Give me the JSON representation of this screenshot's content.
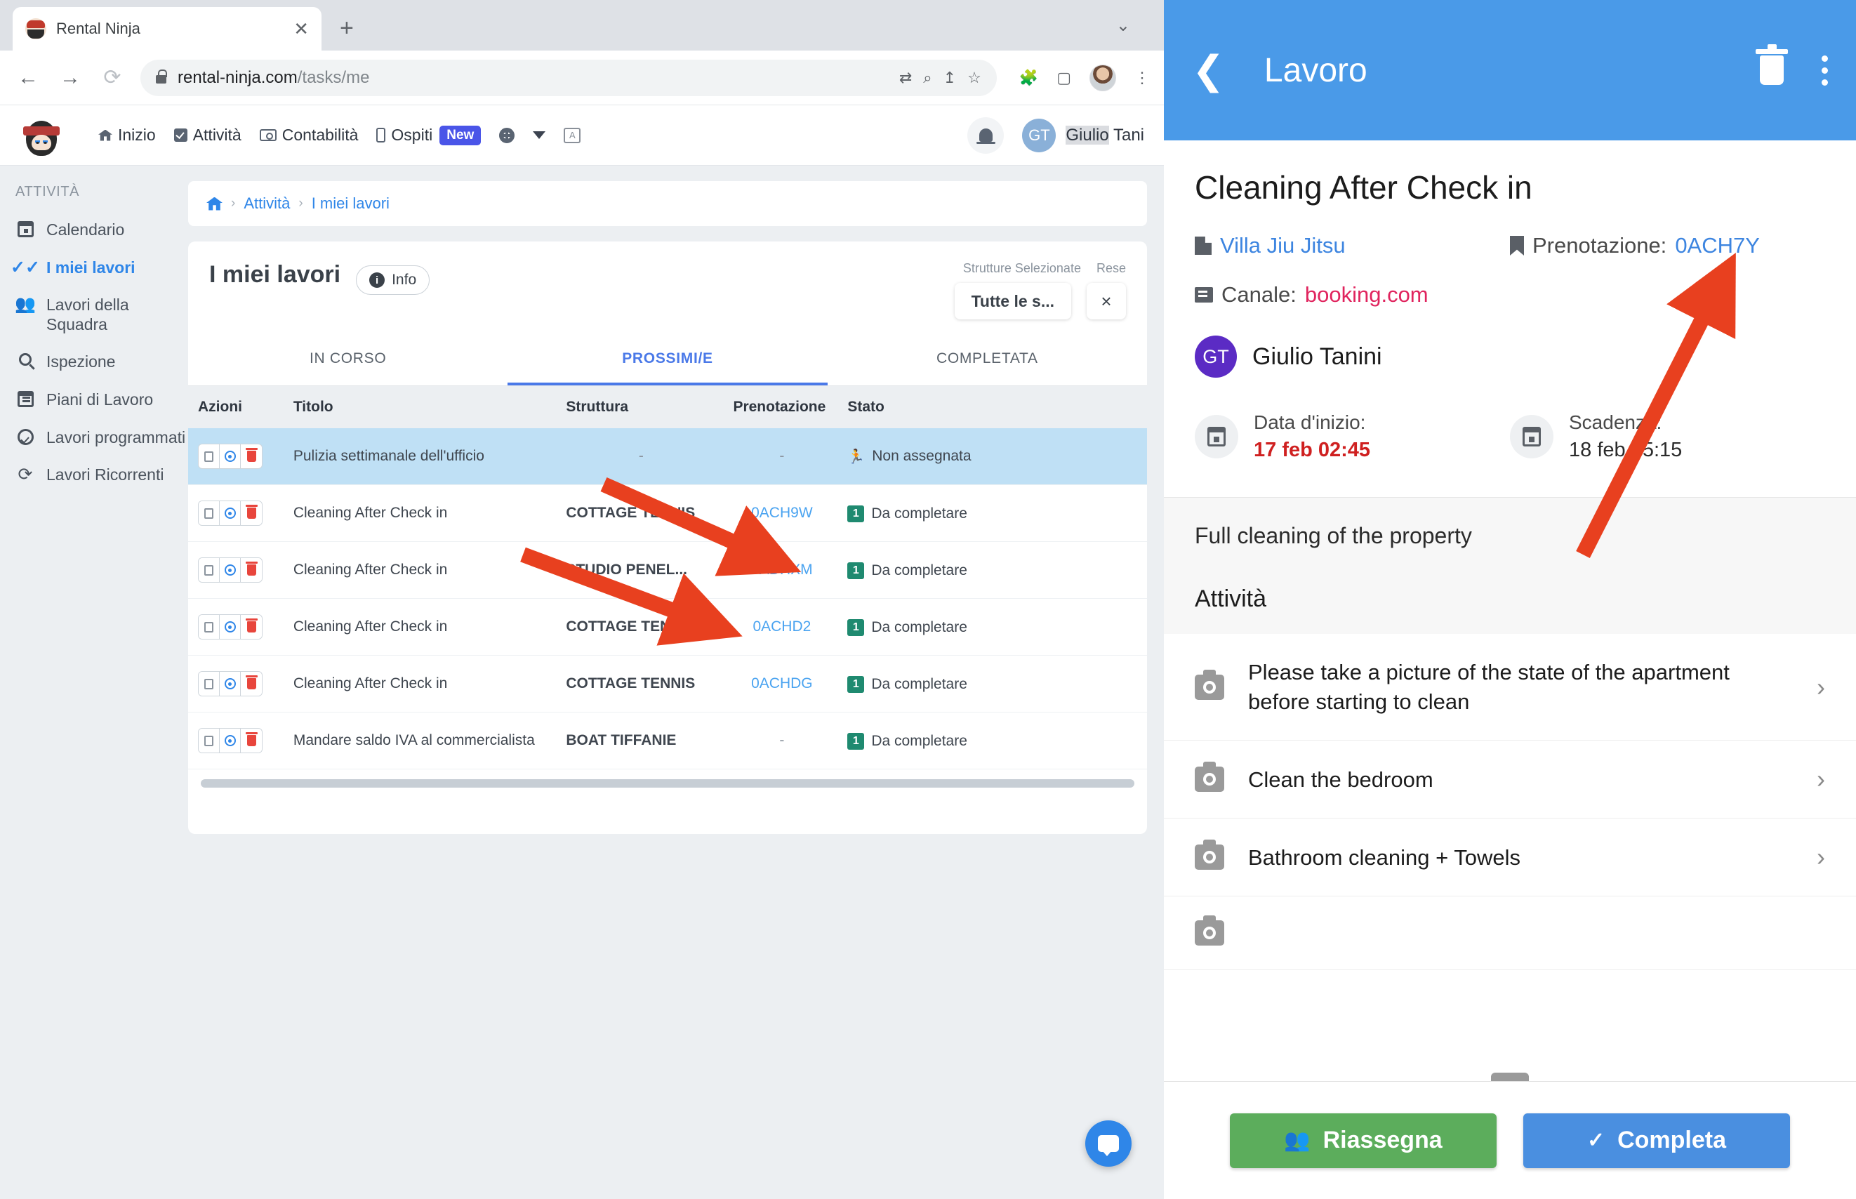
{
  "browser": {
    "tab_title": "Rental Ninja",
    "tab_close": "✕",
    "new_tab": "+",
    "tabstrip_chevron": "⌄",
    "back": "←",
    "forward": "→",
    "reload": "⟳",
    "url_host": "rental-ninja.com",
    "url_path": "/tasks/me",
    "translate_icon": "⇄",
    "zoom_icon": "⌕",
    "share_icon": "↥",
    "bookmark_icon": "☆",
    "extensions_icon": "🧩",
    "sidepanel_icon": "▢",
    "menu_icon": "⋮"
  },
  "app_header": {
    "logo": "ninja-logo",
    "nav": [
      {
        "label": "Inizio",
        "icon": "home-icon"
      },
      {
        "label": "Attività",
        "icon": "checkbox-icon"
      },
      {
        "label": "Contabilità",
        "icon": "money-icon"
      },
      {
        "label": "Ospiti",
        "icon": "phone-icon",
        "badge": "New"
      }
    ],
    "gear_icon": "gear-icon",
    "caret_icon": "chevron-down-icon",
    "translate_icon": "A",
    "bell_icon": "bell-icon",
    "user_initials": "GT",
    "user_name_highlight": "Giulio",
    "user_name_rest": " Tani"
  },
  "sidebar": {
    "section_label": "ATTIVITÀ",
    "items": [
      {
        "label": "Calendario",
        "icon": "calendar-icon",
        "active": false
      },
      {
        "label": "I miei lavori",
        "icon": "double-check-icon",
        "active": true
      },
      {
        "label": "Lavori della Squadra",
        "icon": "people-icon",
        "active": false
      },
      {
        "label": "Ispezione",
        "icon": "search-icon",
        "active": false
      },
      {
        "label": "Piani di Lavoro",
        "icon": "calendar-lines-icon",
        "active": false
      },
      {
        "label": "Lavori programmati",
        "icon": "clock-check-icon",
        "active": false
      },
      {
        "label": "Lavori Ricorrenti",
        "icon": "sync-icon",
        "active": false
      }
    ]
  },
  "breadcrumb": {
    "home_icon": "home-icon",
    "sep": "›",
    "item1": "Attività",
    "item2": "I miei lavori"
  },
  "panel": {
    "title": "I miei lavori",
    "info_label": "Info",
    "info_icon": "info-icon",
    "filter_label_1": "Strutture Selezionate",
    "filter_label_2": "Rese",
    "filter_value": "Tutte le s...",
    "filter_reset": "×"
  },
  "tabs": [
    {
      "label": "IN CORSO",
      "active": false
    },
    {
      "label": "PROSSIMI/E",
      "active": true
    },
    {
      "label": "COMPLETATA",
      "active": false
    }
  ],
  "table": {
    "headers": [
      "Azioni",
      "Titolo",
      "Struttura",
      "Prenotazione",
      "Stato"
    ],
    "rows": [
      {
        "title": "Pulizia settimanale dell'ufficio",
        "struttura": "-",
        "prenotazione": "-",
        "stato": "Non assegnata",
        "stato_type": "unassigned",
        "highlight": true
      },
      {
        "title": "Cleaning After Check in",
        "struttura": "COTTAGE TENNIS",
        "prenotazione": "0ACH9W",
        "stato": "Da completare",
        "stato_badge": "1",
        "stato_type": "todo",
        "highlight": false
      },
      {
        "title": "Cleaning After Check in",
        "struttura": "STUDIO PENEL...",
        "prenotazione": "0ADHXM",
        "stato": "Da completare",
        "stato_badge": "1",
        "stato_type": "todo",
        "highlight": false
      },
      {
        "title": "Cleaning After Check in",
        "struttura": "COTTAGE TENNIS",
        "prenotazione": "0ACHD2",
        "stato": "Da completare",
        "stato_badge": "1",
        "stato_type": "todo",
        "highlight": false
      },
      {
        "title": "Cleaning After Check in",
        "struttura": "COTTAGE TENNIS",
        "prenotazione": "0ACHDG",
        "stato": "Da completare",
        "stato_badge": "1",
        "stato_type": "todo",
        "highlight": false
      },
      {
        "title": "Mandare saldo IVA al commercialista",
        "struttura": "BOAT TIFFANIE",
        "prenotazione": "-",
        "stato": "Da completare",
        "stato_badge": "1",
        "stato_type": "todo",
        "highlight": false
      }
    ]
  },
  "mobile": {
    "header": {
      "back_icon": "back-chevron-icon",
      "title": "Lavoro",
      "delete_icon": "trash-icon",
      "menu_icon": "kebab-menu-icon"
    },
    "job_title": "Cleaning After Check in",
    "property_icon": "building-icon",
    "property": "Villa Jiu Jitsu",
    "booking_icon": "bookmark-icon",
    "booking_label": "Prenotazione:",
    "booking_code": "0ACH7Y",
    "channel_icon": "folder-icon",
    "channel_label": "Canale:",
    "channel_value": "booking.com",
    "user_initials": "GT",
    "user_name": "Giulio Tanini",
    "start_label": "Data d'inizio:",
    "start_value": "17 feb 02:45",
    "due_label": "Scadenza:",
    "due_value": "18 feb 05:15",
    "description": "Full cleaning of the property",
    "tasks_header": "Attività",
    "tasks": [
      {
        "icon": "camera-icon",
        "label": "Please take a picture of the state of the apartment before starting to clean",
        "chevron": "›"
      },
      {
        "icon": "camera-icon",
        "label": "Clean the bedroom",
        "chevron": "›"
      },
      {
        "icon": "camera-icon",
        "label": "Bathroom cleaning + Towels",
        "chevron": "›"
      }
    ],
    "reassign_label": "Riassegna",
    "reassign_icon": "people-icon",
    "complete_label": "Completa",
    "complete_icon": "check-icon"
  },
  "colors": {
    "accent_blue": "#4a9ae8",
    "link_blue": "#2f86e8",
    "green": "#5cad5c",
    "red_arrow": "#e8401f",
    "badge_purple": "#4a55e8",
    "status_green": "#1f8a70",
    "pink": "#e0245e"
  }
}
